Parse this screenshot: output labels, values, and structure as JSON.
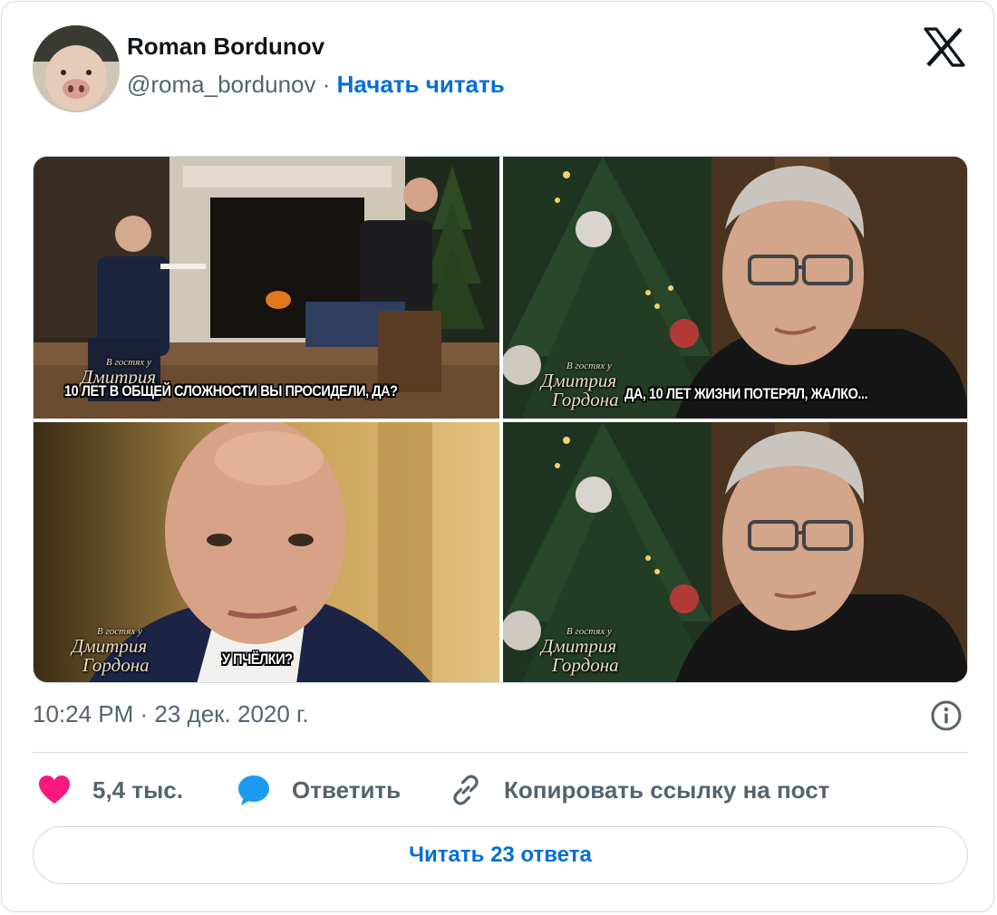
{
  "tweet": {
    "author_name": "Roman Bordunov",
    "handle": "@roma_bordunov",
    "separator": "·",
    "follow_label": "Начать читать",
    "timestamp": "10:24 PM · 23 дек. 2020 г.",
    "brand_icon": "x-logo-icon",
    "media": [
      {
        "caption": "10 ЛЕТ В ОБЩЕЙ СЛОЖНОСТИ ВЫ ПРОСИДЕЛИ, ДА?"
      },
      {
        "caption": "ДА, 10 ЛЕТ ЖИЗНИ ПОТЕРЯЛ, ЖАЛКО..."
      },
      {
        "caption": "У ПЧЁЛКИ?"
      },
      {
        "caption": ""
      }
    ],
    "watermark": {
      "line1": "В гостях у",
      "line2": "Дмитрия",
      "line3": "Гордона"
    }
  },
  "actions": {
    "like_count": "5,4 тыс.",
    "reply_label": "Ответить",
    "copy_label": "Копировать ссылку на пост"
  },
  "read_replies_label": "Читать 23 ответа",
  "colors": {
    "accent": "#006fd6",
    "like": "#f91880",
    "reply": "#1d9bf0",
    "muted": "#536471",
    "border": "#cfd9de"
  }
}
